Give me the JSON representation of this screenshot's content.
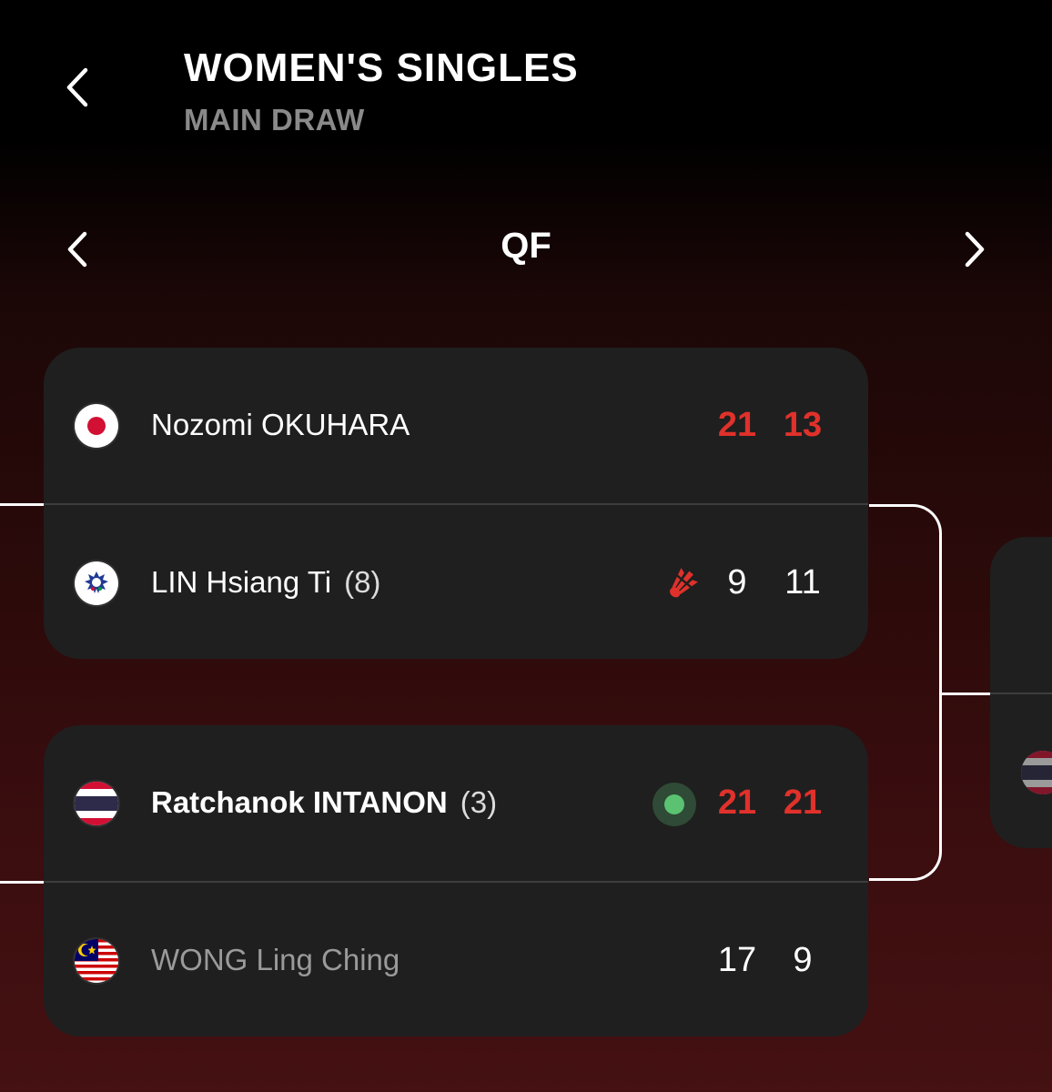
{
  "header": {
    "title": "WOMEN'S SINGLES",
    "subtitle": "MAIN DRAW",
    "back_icon": "chevron-left-icon"
  },
  "round_nav": {
    "label": "QF",
    "prev_icon": "chevron-left-icon",
    "next_icon": "chevron-right-icon"
  },
  "matches": [
    {
      "players": [
        {
          "name": "Nozomi OKUHARA",
          "seed": "",
          "flag": "japan-flag-icon",
          "scores": [
            "21",
            "13"
          ],
          "scores_highlighted": true,
          "serving": false,
          "winner": false
        },
        {
          "name": "LIN Hsiang Ti",
          "seed": "(8)",
          "flag": "chinese-taipei-flag-icon",
          "scores": [
            "9",
            "11"
          ],
          "scores_highlighted": false,
          "serving": true,
          "winner": false
        }
      ]
    },
    {
      "players": [
        {
          "name": "Ratchanok INTANON",
          "seed": "(3)",
          "flag": "thailand-flag-icon",
          "scores": [
            "21",
            "21"
          ],
          "scores_highlighted": true,
          "serving": false,
          "winner": true
        },
        {
          "name": "WONG Ling Ching",
          "seed": "",
          "flag": "malaysia-flag-icon",
          "scores": [
            "17",
            "9"
          ],
          "scores_highlighted": false,
          "serving": false,
          "winner": false
        }
      ]
    }
  ],
  "colors": {
    "accent_red": "#e0312b",
    "card_bg": "#1f1f1f",
    "live_green": "#5ac271",
    "muted_text": "#9a9a9a"
  }
}
